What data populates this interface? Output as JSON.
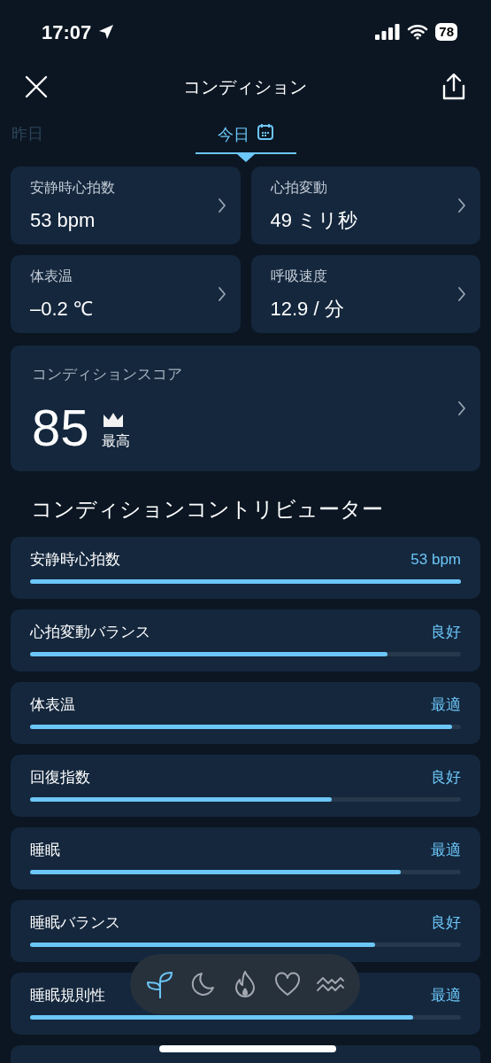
{
  "status_bar": {
    "time": "17:07",
    "battery": "78"
  },
  "header": {
    "title": "コンディション"
  },
  "tabs": [
    {
      "label": "昨日",
      "selected": false
    },
    {
      "label": "今日",
      "selected": true
    }
  ],
  "metrics": [
    {
      "label": "安静時心拍数",
      "value": "53 bpm"
    },
    {
      "label": "心拍変動",
      "value": "49 ミリ秒"
    },
    {
      "label": "体表温",
      "value": "–0.2 ℃"
    },
    {
      "label": "呼吸速度",
      "value": "12.9 / 分"
    }
  ],
  "score": {
    "label": "コンディションスコア",
    "value": "85",
    "rating": "最高"
  },
  "contributors_heading": "コンディションコントリビューター",
  "contributors": [
    {
      "name": "安静時心拍数",
      "reading": "53 bpm",
      "level": 1.0
    },
    {
      "name": "心拍変動バランス",
      "reading": "良好",
      "level": 0.83
    },
    {
      "name": "体表温",
      "reading": "最適",
      "level": 0.98
    },
    {
      "name": "回復指数",
      "reading": "良好",
      "level": 0.7
    },
    {
      "name": "睡眠",
      "reading": "最適",
      "level": 0.86
    },
    {
      "name": "睡眠バランス",
      "reading": "良好",
      "level": 0.8
    },
    {
      "name": "睡眠規則性",
      "reading": "最適",
      "level": 0.89
    }
  ],
  "bottom_nav": [
    {
      "kind": "sprout",
      "selected": true
    },
    {
      "kind": "moon",
      "selected": false
    },
    {
      "kind": "flame",
      "selected": false
    },
    {
      "kind": "heart",
      "selected": false
    },
    {
      "kind": "waves",
      "selected": false
    }
  ]
}
